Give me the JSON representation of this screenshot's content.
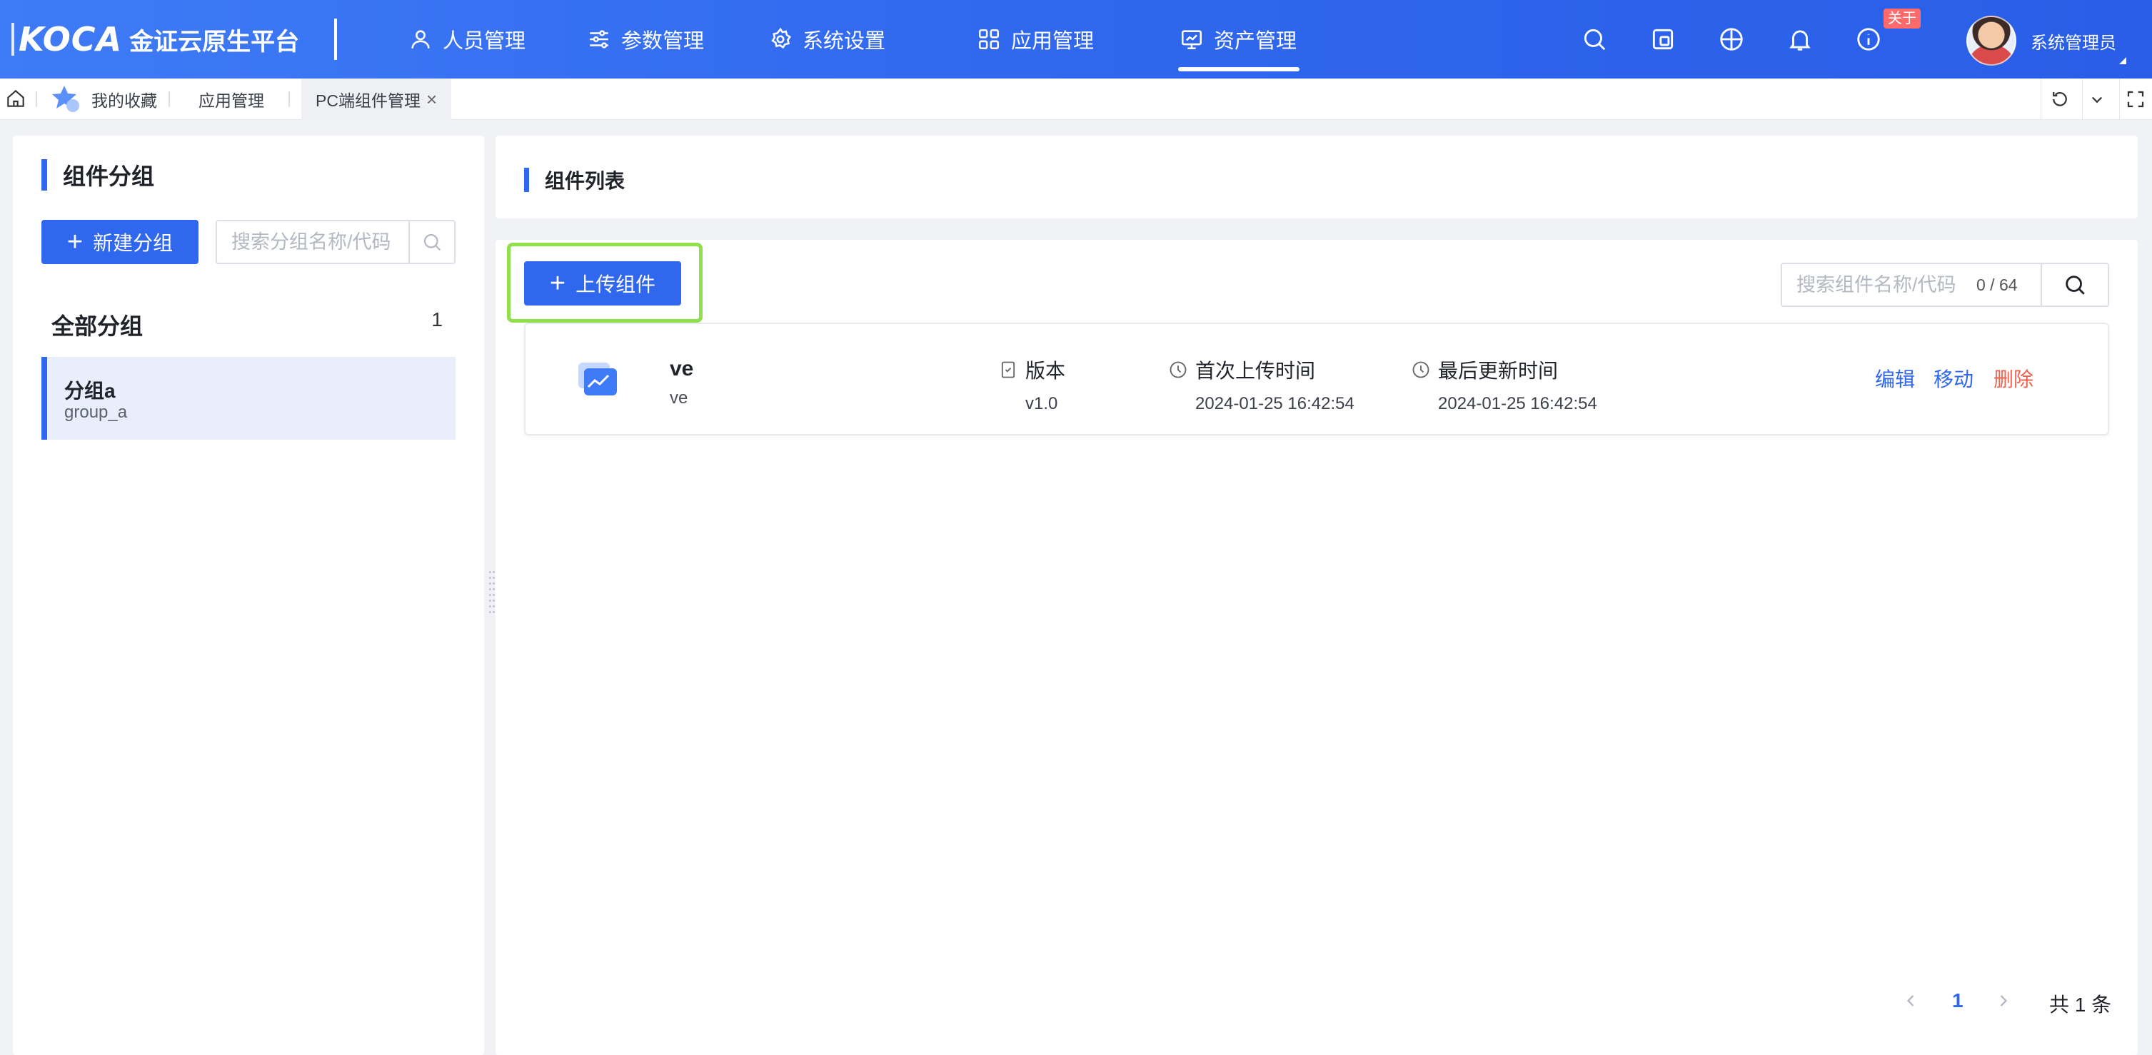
{
  "header": {
    "logo_text": "KOCA",
    "brand_name": "金证云原生平台",
    "nav": [
      {
        "label": "人员管理",
        "icon": "user-icon"
      },
      {
        "label": "参数管理",
        "icon": "sliders-icon"
      },
      {
        "label": "系统设置",
        "icon": "gear-icon"
      },
      {
        "label": "应用管理",
        "icon": "grid-icon"
      },
      {
        "label": "资产管理",
        "icon": "monitor-chart-icon",
        "active": true
      }
    ],
    "tools": [
      "search-icon",
      "window-icon",
      "globe-icon",
      "bell-icon",
      "info-icon"
    ],
    "about_badge": "关于",
    "user_name": "系统管理员"
  },
  "tabs": {
    "items": [
      {
        "label": "我的收藏"
      },
      {
        "label": "应用管理"
      },
      {
        "label": "PC端组件管理",
        "current": true
      }
    ],
    "close_glyph": "×"
  },
  "left": {
    "title": "组件分组",
    "new_group_label": "新建分组",
    "search_placeholder": "搜索分组名称/代码",
    "all_groups": {
      "label": "全部分组",
      "count": "1"
    },
    "groups": [
      {
        "name": "分组a",
        "code": "group_a",
        "selected": true
      }
    ]
  },
  "right": {
    "title": "组件列表",
    "upload_label": "上传组件",
    "search_placeholder": "搜索组件名称/代码",
    "search_counter": "0 / 64",
    "components": [
      {
        "name": "ve",
        "code": "ve",
        "version_label": "版本",
        "version": "v1.0",
        "first_upload_label": "首次上传时间",
        "first_upload": "2024-01-25 16:42:54",
        "last_update_label": "最后更新时间",
        "last_update": "2024-01-25 16:42:54",
        "actions": {
          "edit": "编辑",
          "move": "移动",
          "delete": "删除"
        }
      }
    ],
    "pagination": {
      "current_page": "1",
      "total_text": "共 1 条"
    }
  },
  "colors": {
    "primary": "#2f67ee",
    "danger": "#f0604d",
    "highlight": "#8fe04a"
  }
}
